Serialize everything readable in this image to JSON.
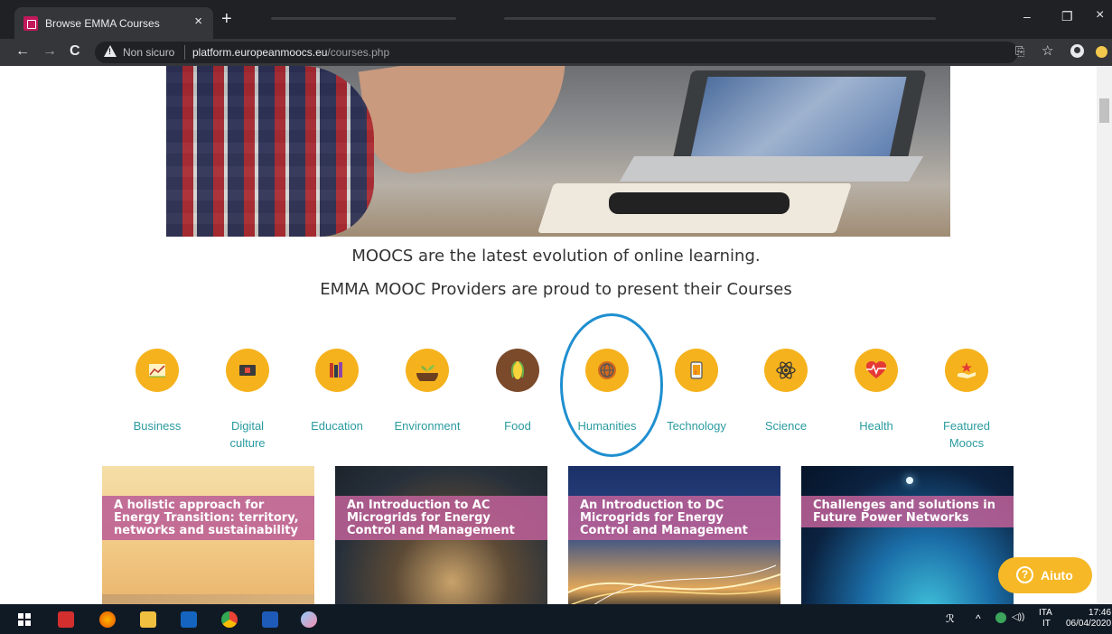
{
  "browser": {
    "tab_title": "Browse EMMA Courses",
    "tab_close": "×",
    "new_tab": "+",
    "security_label": "Non sicuro",
    "url_host": "platform.europeanmoocs.eu",
    "url_path": "/courses.php",
    "back": "←",
    "forward": "→",
    "reload": "C",
    "bookmark_star": "☆",
    "translate_icon": "⎘",
    "minimize": "–",
    "restore": "❐",
    "close": "×"
  },
  "page": {
    "lead_line1": "MOOCS are the latest evolution of online learning.",
    "lead_line2": "EMMA MOOC Providers are proud to present their Courses",
    "categories": [
      {
        "label": "Business",
        "icon": "business-chart-icon"
      },
      {
        "label": "Digital culture",
        "icon": "digital-screen-icon"
      },
      {
        "label": "Education",
        "icon": "books-icon"
      },
      {
        "label": "Environment",
        "icon": "sprout-icon"
      },
      {
        "label": "Food",
        "icon": "corn-icon"
      },
      {
        "label": "Humanities",
        "icon": "globe-icon"
      },
      {
        "label": "Technology",
        "icon": "tablet-icon"
      },
      {
        "label": "Science",
        "icon": "atom-icon"
      },
      {
        "label": "Health",
        "icon": "heartbeat-icon"
      },
      {
        "label": "Featured Moocs",
        "icon": "star-hand-icon"
      }
    ],
    "courses": [
      {
        "title": "A holistic approach for Energy Transition: territory, networks and sustainability"
      },
      {
        "title": "An Introduction to AC Microgrids for Energy Control and Management"
      },
      {
        "title": "An Introduction to DC Microgrids for Energy Control and Management"
      },
      {
        "title": "Challenges and solutions in Future Power Networks"
      }
    ],
    "help_button": "Aiuto",
    "help_icon_glyph": "?"
  },
  "taskbar": {
    "time": "17:46",
    "date": "06/04/2020",
    "lang_top": "ITA",
    "lang_bottom": "IT",
    "tray_people": "ℛ",
    "tray_chevron": "^",
    "tray_sound": "◁))"
  },
  "colors": {
    "accent_teal": "#2a9ba0",
    "icon_yellow": "#f5b21d",
    "card_band": "#bc6096",
    "help_yellow": "#f6b826",
    "annotation_blue": "#1f8fd0"
  }
}
